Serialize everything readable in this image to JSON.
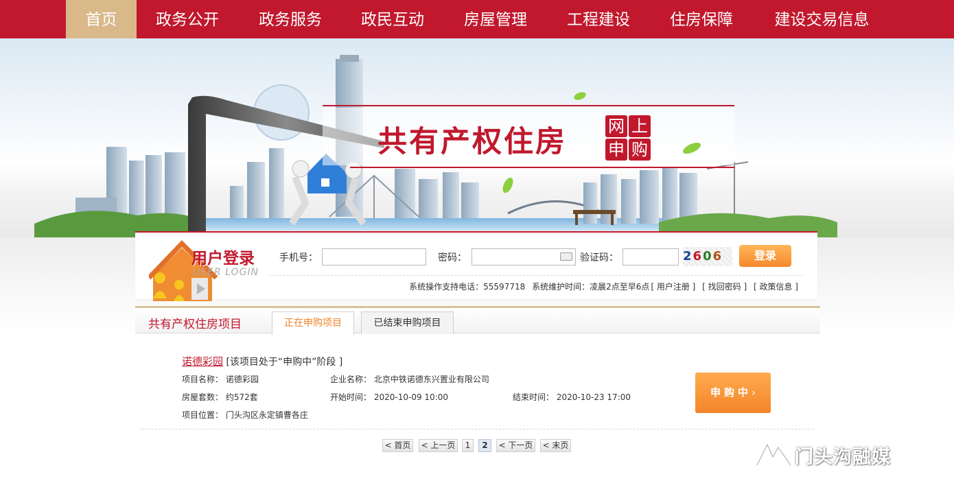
{
  "nav": {
    "items": [
      "首页",
      "政务公开",
      "政务服务",
      "政民互动",
      "房屋管理",
      "工程建设",
      "住房保障",
      "建设交易信息"
    ],
    "active_index": 0
  },
  "banner": {
    "title": "共有产权住房",
    "badge": [
      "网",
      "上",
      "申",
      "购"
    ]
  },
  "login": {
    "title": "用户登录",
    "subtitle": "USER LOGIN",
    "phone_label": "手机号：",
    "password_label": "密码：",
    "captcha_label": "验证码：",
    "captcha_chars": [
      "2",
      "6",
      "0",
      "6"
    ],
    "button": "登录",
    "support": "系统操作支持电话：55597718",
    "maintenance": "系统维护时间：凌晨2点至早6点",
    "links": [
      "[ 用户注册 ]",
      "[ 找回密码 ]",
      "[ 政策信息 ]"
    ]
  },
  "projects": {
    "section_title": "共有产权住房项目",
    "tabs": [
      "正在申购项目",
      "已结束申购项目"
    ],
    "active_tab": 0,
    "item": {
      "name": "诺德彩园",
      "status": "[该项目处于“申购中”阶段 ]",
      "project_name_label": "项目名称：",
      "project_name": "诺德彩园",
      "company_label": "企业名称：",
      "company": "北京中铁诺德东兴置业有限公司",
      "units_label": "房屋套数：",
      "units": "约572套",
      "start_label": "开始时间：",
      "start": "2020-10-09 10:00",
      "end_label": "结束时间：",
      "end": "2020-10-23 17:00",
      "location_label": "项目位置：",
      "location": "门头沟区永定镇曹各庄",
      "apply_button": "申购中"
    },
    "pagination": [
      "< 首页",
      "< 上一页",
      "1",
      "2",
      "< 下一页",
      "< 末页"
    ],
    "current_page": "2"
  },
  "watermark": "门头沟融媒",
  "colors": {
    "brand_red": "#c1182d",
    "nav_active": "#d9b98a",
    "orange": "#f4842b",
    "tab_active_text": "#f0842a",
    "gold_line": "#d7c39a"
  }
}
